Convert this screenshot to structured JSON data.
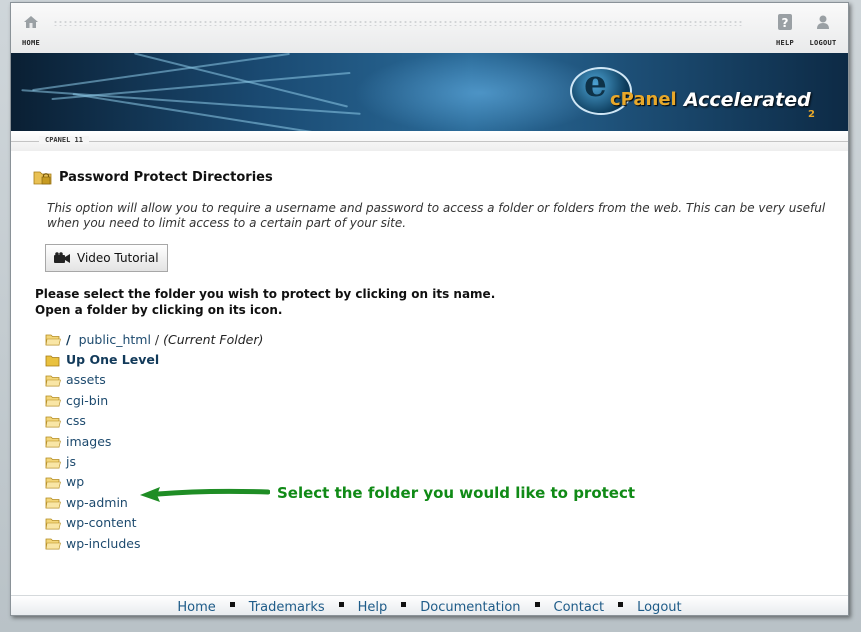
{
  "topbar": {
    "home_label": "HOME",
    "help_label": "HELP",
    "logout_label": "LOGOUT"
  },
  "banner": {
    "brand_cpanel": "cPanel",
    "brand_accelerated": "Accelerated",
    "brand_version": "2"
  },
  "section_tag": "CPANEL 11",
  "page": {
    "title": "Password Protect Directories",
    "description": "This option will allow you to require a username and password to access a folder or folders from the web. This can be very useful when you need to limit access to a certain part of your site.",
    "video_button": "Video Tutorial",
    "instruction_line1": "Please select the folder you wish to protect by clicking on its name.",
    "instruction_line2": "Open a folder by clicking on its icon."
  },
  "path": {
    "root": "/",
    "folder": "public_html",
    "separator": "/",
    "current": "(Current Folder)"
  },
  "up_one_level": "Up One Level",
  "folders": [
    "assets",
    "cgi-bin",
    "css",
    "images",
    "js",
    "wp",
    "wp-admin",
    "wp-content",
    "wp-includes"
  ],
  "annotation": {
    "text": "Select the folder you would like to protect",
    "color": "#108a16"
  },
  "footer": {
    "links": [
      "Home",
      "Trademarks",
      "Help",
      "Documentation",
      "Contact",
      "Logout"
    ]
  },
  "colors": {
    "link": "#1d4a6e",
    "footer_link": "#1e5b88",
    "brand_orange": "#e8a82a"
  }
}
